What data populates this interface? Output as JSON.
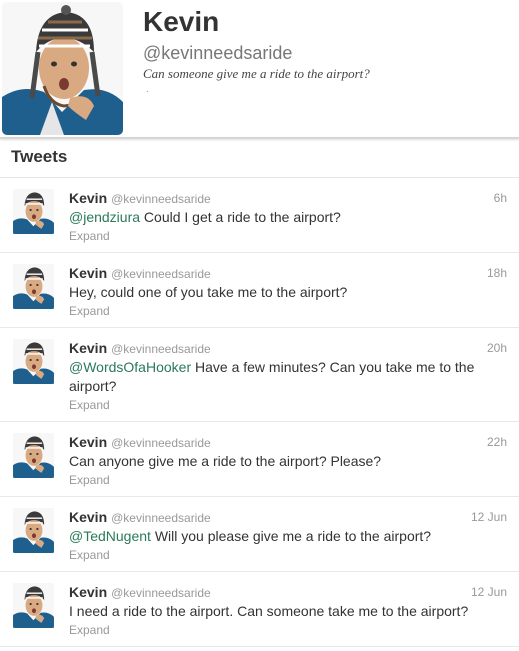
{
  "profile": {
    "name": "Kevin",
    "handle": "@kevinneedsaride",
    "bio": "Can someone give me a ride to the airport?",
    "bio_mark": "."
  },
  "tweets_header": {
    "title": "Tweets"
  },
  "tweets": [
    {
      "name": "Kevin",
      "handle": "@kevinneedsaride",
      "time": "6h",
      "mention": "@jendziura",
      "text": " Could I get a ride to the airport?",
      "expand": "Expand"
    },
    {
      "name": "Kevin",
      "handle": "@kevinneedsaride",
      "time": "18h",
      "mention": "",
      "text": "Hey, could one of you take me to the airport?",
      "expand": "Expand"
    },
    {
      "name": "Kevin",
      "handle": "@kevinneedsaride",
      "time": "20h",
      "mention": "@WordsOfaHooker",
      "text": " Have a few minutes? Can you take me to the airport?",
      "expand": "Expand"
    },
    {
      "name": "Kevin",
      "handle": "@kevinneedsaride",
      "time": "22h",
      "mention": "",
      "text": "Can anyone give me a ride to the airport? Please?",
      "expand": "Expand"
    },
    {
      "name": "Kevin",
      "handle": "@kevinneedsaride",
      "time": "12 Jun",
      "mention": "@TedNugent",
      "text": " Will you please give me a ride to the airport?",
      "expand": "Expand"
    },
    {
      "name": "Kevin",
      "handle": "@kevinneedsaride",
      "time": "12 Jun",
      "mention": "",
      "text": "I need a ride to the airport. Can someone take me to the airport?",
      "expand": "Expand"
    }
  ],
  "colors": {
    "mention": "#2a7a5a",
    "meta": "#999999",
    "text": "#333333"
  },
  "icons": {
    "avatar": "man-with-knit-hat-photo"
  }
}
